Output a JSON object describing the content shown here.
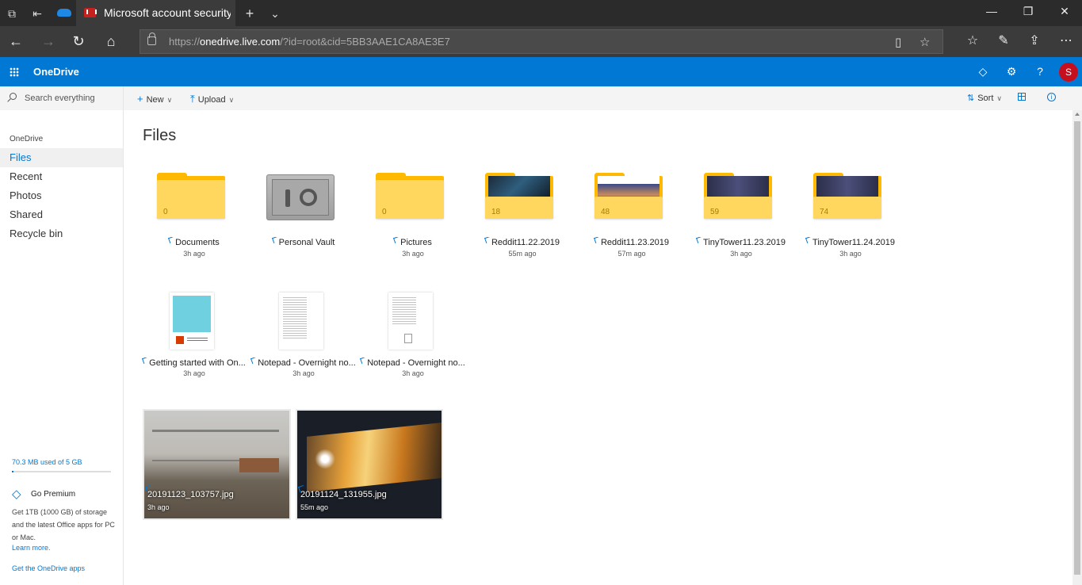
{
  "browser": {
    "tab_title": "Microsoft account security c",
    "url_host": "onedrive.live.com",
    "url_prefix": "https://",
    "url_rest": "/?id=root&cid=5BB3AAE1CA8AE3E7"
  },
  "header": {
    "app_name": "OneDrive",
    "avatar_letter": "S"
  },
  "sidebar": {
    "search_placeholder": "Search everything",
    "section": "OneDrive",
    "items": [
      {
        "label": "Files"
      },
      {
        "label": "Recent"
      },
      {
        "label": "Photos"
      },
      {
        "label": "Shared"
      },
      {
        "label": "Recycle bin"
      }
    ],
    "quota_text": "70.3 MB used of 5 GB",
    "quota_fraction": 0.014,
    "premium_title": "Go Premium",
    "premium_desc": "Get 1TB (1000 GB) of storage and the latest Office apps for PC or Mac.",
    "learn_more": "Learn more.",
    "get_apps": "Get the OneDrive apps"
  },
  "toolbar": {
    "new_label": "New",
    "upload_label": "Upload",
    "sort_label": "Sort"
  },
  "main": {
    "title": "Files",
    "folders": [
      {
        "name": "Documents",
        "time": "3h ago",
        "count": "0"
      },
      {
        "name": "Personal Vault",
        "time": ""
      },
      {
        "name": "Pictures",
        "time": "3h ago",
        "count": "0"
      },
      {
        "name": "Reddit11.22.2019",
        "time": "55m ago",
        "count": "18"
      },
      {
        "name": "Reddit11.23.2019",
        "time": "57m ago",
        "count": "48"
      },
      {
        "name": "TinyTower11.23.2019",
        "time": "3h ago",
        "count": "59"
      },
      {
        "name": "TinyTower11.24.2019",
        "time": "3h ago",
        "count": "74"
      }
    ],
    "files": [
      {
        "name": "Getting started with On...",
        "time": "3h ago"
      },
      {
        "name": "Notepad - Overnight no...",
        "time": "3h ago"
      },
      {
        "name": "Notepad - Overnight no...",
        "time": "3h ago"
      }
    ],
    "photos": [
      {
        "name": "20191123_103757.jpg",
        "time": "3h ago"
      },
      {
        "name": "20191124_131955.jpg",
        "time": "55m ago"
      }
    ]
  },
  "colors": {
    "brand": "#0078d4",
    "folder": "#ffd75e",
    "avatar": "#c50f1f"
  }
}
